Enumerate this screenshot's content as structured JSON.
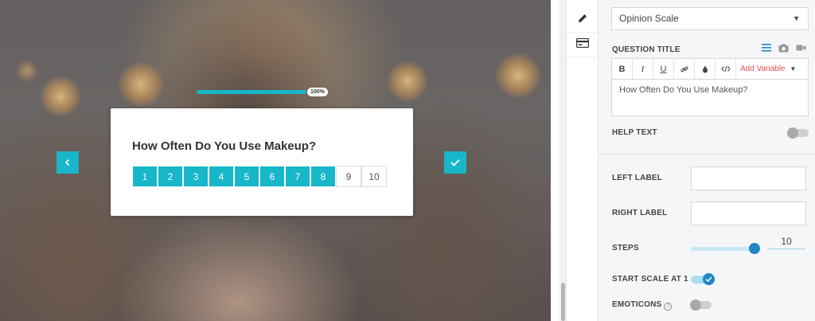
{
  "preview": {
    "progress": {
      "percent_label": "100%",
      "fraction": 1.0
    },
    "question": "How Often Do You Use Makeup?",
    "scale": {
      "steps": [
        "1",
        "2",
        "3",
        "4",
        "5",
        "6",
        "7",
        "8",
        "9",
        "10"
      ],
      "selected_up_to": 8
    },
    "accent_color": "#17b6c9"
  },
  "rail": {
    "items": [
      {
        "icon": "pencil-icon"
      },
      {
        "icon": "credit-card-icon"
      }
    ]
  },
  "panel": {
    "question_type": "Opinion Scale",
    "question_title_label": "QUESTION TITLE",
    "toolbar": {
      "bold": "B",
      "italic": "I",
      "underline": "U",
      "add_variable": "Add Variable"
    },
    "question_title_value": "How Often Do You Use Makeup?",
    "help_text_label": "HELP TEXT",
    "help_text_enabled": false,
    "left_label": "LEFT LABEL",
    "left_label_value": "",
    "right_label": "RIGHT LABEL",
    "right_label_value": "",
    "steps_label": "STEPS",
    "steps_value": "10",
    "steps_fraction": 1.0,
    "start_scale_label": "START SCALE AT 1",
    "start_scale_enabled": true,
    "emoticons_label": "EMOTICONS",
    "emoticons_enabled": false
  }
}
